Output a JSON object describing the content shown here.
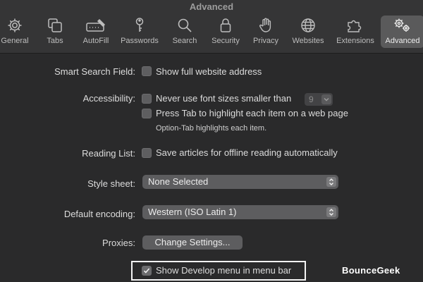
{
  "window": {
    "title": "Advanced"
  },
  "tabs": [
    {
      "label": "General",
      "icon": "gear-icon"
    },
    {
      "label": "Tabs",
      "icon": "tabs-icon"
    },
    {
      "label": "AutoFill",
      "icon": "autofill-icon"
    },
    {
      "label": "Passwords",
      "icon": "key-icon"
    },
    {
      "label": "Search",
      "icon": "search-icon"
    },
    {
      "label": "Security",
      "icon": "lock-icon"
    },
    {
      "label": "Privacy",
      "icon": "hand-icon"
    },
    {
      "label": "Websites",
      "icon": "globe-icon"
    },
    {
      "label": "Extensions",
      "icon": "puzzle-icon"
    },
    {
      "label": "Advanced",
      "icon": "gears-icon",
      "active": true
    }
  ],
  "settings": {
    "smart_search": {
      "label": "Smart Search Field:",
      "option": "Show full website address",
      "checked": false
    },
    "accessibility": {
      "label": "Accessibility:",
      "min_font_option": "Never use font sizes smaller than",
      "min_font_value": "9",
      "min_font_checked": false,
      "tab_option": "Press Tab to highlight each item on a web page",
      "tab_checked": false,
      "tab_note": "Option-Tab highlights each item."
    },
    "reading_list": {
      "label": "Reading List:",
      "option": "Save articles for offline reading automatically",
      "checked": false
    },
    "style_sheet": {
      "label": "Style sheet:",
      "value": "None Selected"
    },
    "encoding": {
      "label": "Default encoding:",
      "value": "Western (ISO Latin 1)"
    },
    "proxies": {
      "label": "Proxies:",
      "button": "Change Settings..."
    },
    "develop_menu": {
      "option": "Show Develop menu in menu bar",
      "checked": true
    }
  },
  "watermark": "BounceGeek",
  "colors": {
    "background": "#2a2a2b",
    "toolbar": "#353536",
    "active_tab": "#5a5a5b",
    "highlight": "#f4f4f4"
  }
}
